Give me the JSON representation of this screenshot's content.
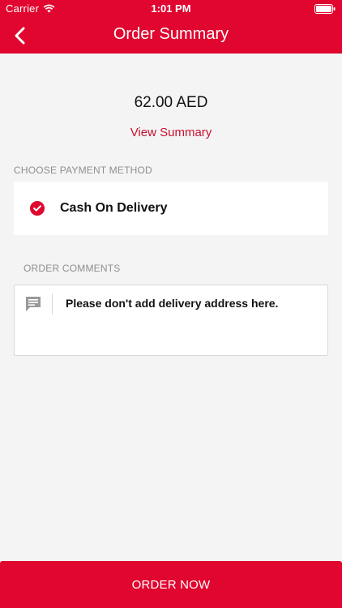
{
  "status_bar": {
    "carrier": "Carrier",
    "time": "1:01 PM"
  },
  "nav": {
    "title": "Order Summary"
  },
  "summary": {
    "amount": "62.00 AED",
    "view_summary_label": "View Summary"
  },
  "payment": {
    "section_label": "CHOOSE PAYMENT METHOD",
    "selected_method": "Cash On Delivery"
  },
  "comments": {
    "section_label": "ORDER COMMENTS",
    "placeholder": "Please don't add delivery address here."
  },
  "footer": {
    "order_button_label": "ORDER NOW"
  },
  "colors": {
    "brand_red": "#e0062f",
    "link_red": "#c8102e",
    "background": "#f4f4f4"
  }
}
